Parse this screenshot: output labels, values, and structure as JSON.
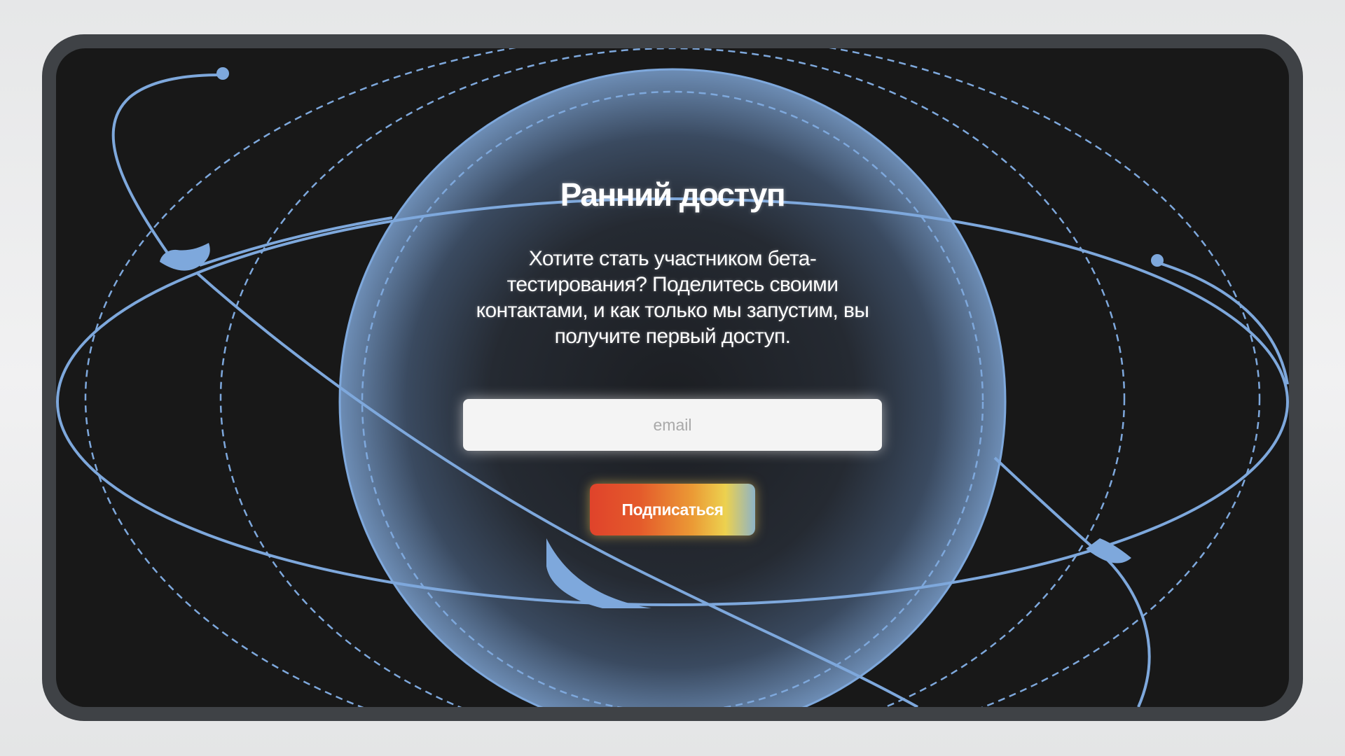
{
  "page": {
    "title": "Ранний доступ",
    "description": "Хотите стать участником бета-тестирования? Поделитесь своими контактами, и как только мы запустим, вы получите первый доступ."
  },
  "form": {
    "email_placeholder": "email",
    "email_value": "",
    "submit_label": "Подписаться"
  },
  "colors": {
    "background": "#181818",
    "frame": "#3f4246",
    "orbit_lines": "#7ea8dc",
    "button_gradient": [
      "#e0432b",
      "#eb9a35",
      "#ecd14f",
      "#8eb3c6"
    ],
    "input_background": "#f4f4f4"
  }
}
